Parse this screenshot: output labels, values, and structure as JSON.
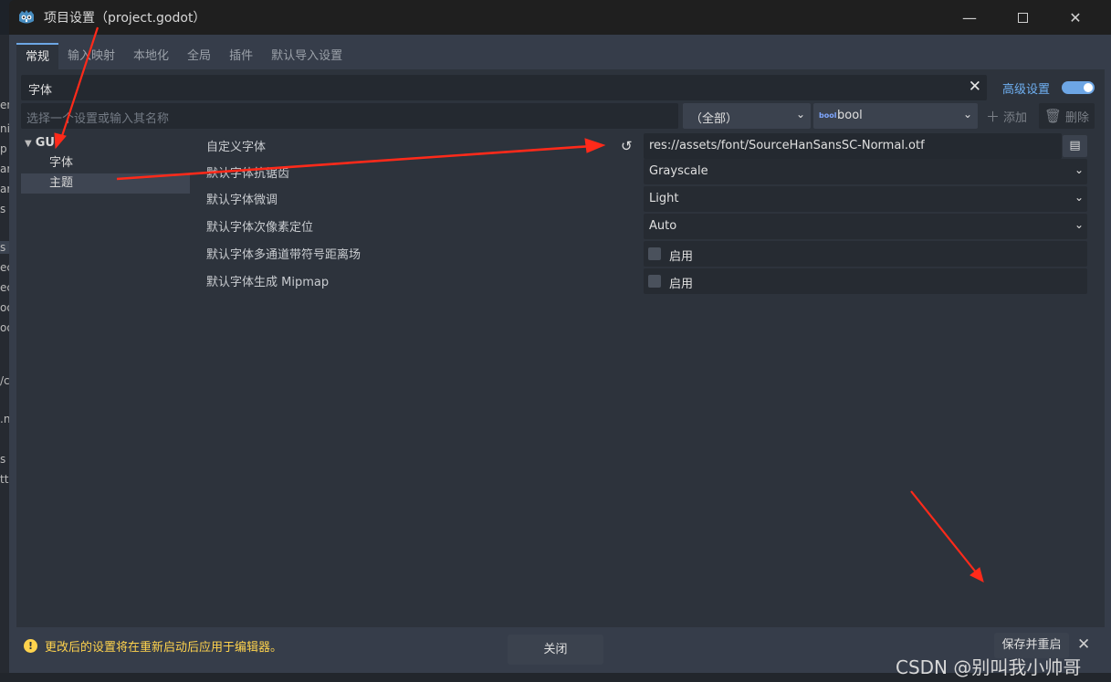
{
  "window": {
    "title": "项目设置（project.godot）",
    "minimize_icon": "minimize-icon",
    "maximize_icon": "maximize-icon",
    "close_icon": "close-icon"
  },
  "background_editor": {
    "left_strip_text": [
      "en",
      "ni",
      "p",
      "ar",
      "ar",
      "s",
      "s",
      "ec",
      "ec",
      "oo",
      "oo",
      "/c",
      ".n",
      "s",
      "tt"
    ]
  },
  "tabs": [
    {
      "label": "常规",
      "active": true
    },
    {
      "label": "输入映射",
      "active": false
    },
    {
      "label": "本地化",
      "active": false
    },
    {
      "label": "全局",
      "active": false
    },
    {
      "label": "插件",
      "active": false
    },
    {
      "label": "默认导入设置",
      "active": false
    }
  ],
  "filter": {
    "value": "字体",
    "clear_icon": "close-icon"
  },
  "advanced": {
    "label": "高级设置",
    "enabled": true
  },
  "search": {
    "placeholder": "选择一个设置或输入其名称"
  },
  "category_select": {
    "value": "（全部）"
  },
  "type_select": {
    "badge": "bool",
    "value": "bool"
  },
  "add_button": {
    "label": "添加"
  },
  "delete_button": {
    "label": "删除"
  },
  "tree": {
    "root": "GUI",
    "children": [
      {
        "label": "字体",
        "selected": false
      },
      {
        "label": "主题",
        "selected": true
      }
    ]
  },
  "properties": [
    {
      "label": "自定义字体",
      "type": "path",
      "value": "res://assets/font/SourceHanSansSC-Normal.otf"
    },
    {
      "label": "默认字体抗锯齿",
      "type": "enum",
      "value": "Grayscale"
    },
    {
      "label": "默认字体微调",
      "type": "enum",
      "value": "Light"
    },
    {
      "label": "默认字体次像素定位",
      "type": "enum",
      "value": "Auto"
    },
    {
      "label": "默认字体多通道带符号距离场",
      "type": "bool",
      "value": "启用"
    },
    {
      "label": "默认字体生成 Mipmap",
      "type": "bool",
      "value": "启用"
    }
  ],
  "warning": {
    "text": "更改后的设置将在重新启动后应用于编辑器。"
  },
  "restart_button": {
    "label": "保存并重启"
  },
  "close_button": {
    "label": "关闭"
  },
  "watermark": "CSDN @别叫我小帅哥",
  "colors": {
    "accent": "#6da6e5",
    "warning": "#ffd34d",
    "annotation_arrow": "#ff2a1a"
  }
}
